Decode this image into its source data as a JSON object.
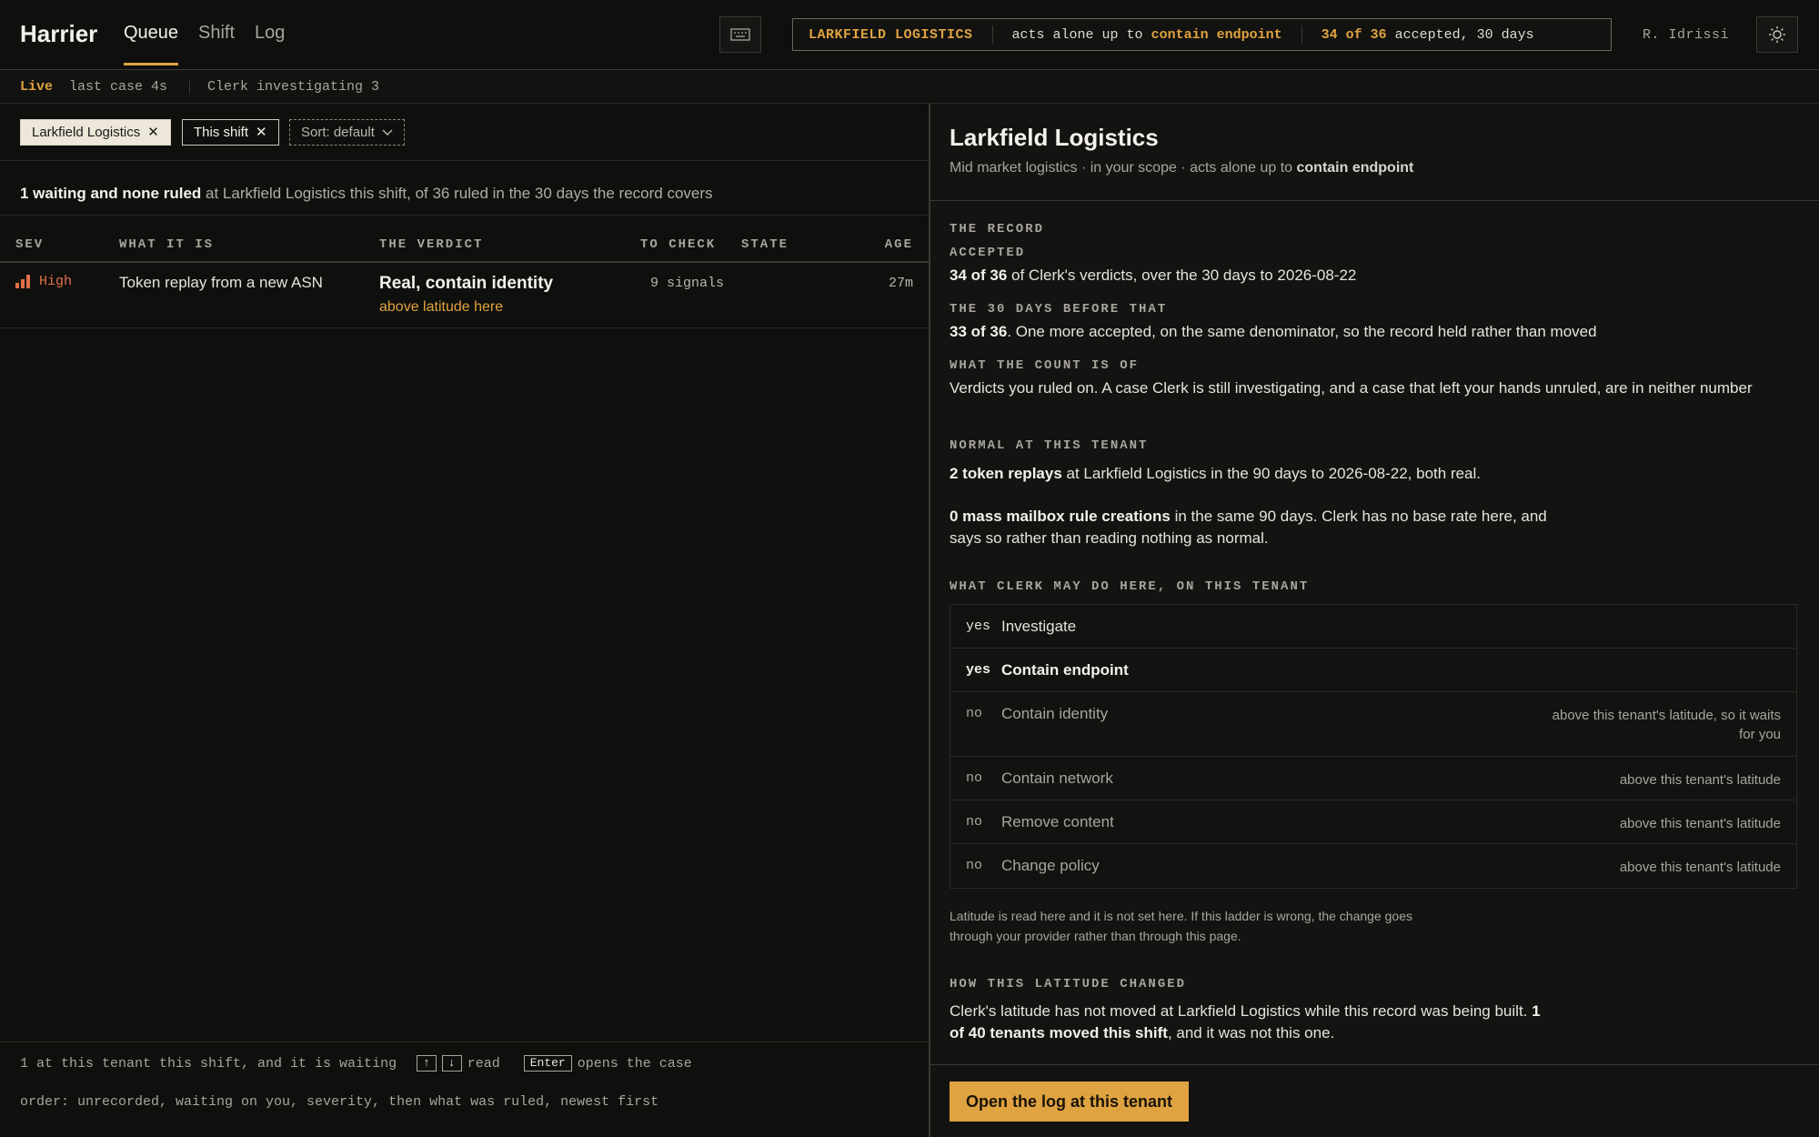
{
  "app": {
    "brand": "Harrier",
    "tabs": [
      {
        "label": "Queue",
        "active": true
      },
      {
        "label": "Shift",
        "active": false
      },
      {
        "label": "Log",
        "active": false
      }
    ],
    "user": "R. Idrissi",
    "icons": {
      "keyboard": "keyboard-icon",
      "theme": "sun-icon"
    }
  },
  "scope": {
    "tenant": "LARKFIELD LOGISTICS",
    "acts_prefix": "acts alone up to",
    "acts_level": "contain endpoint",
    "record_count": "34 of 36",
    "record_suffix": "accepted, 30 days"
  },
  "status": {
    "live": "Live",
    "last_case": "last case 4s",
    "clerk": "Clerk investigating 3"
  },
  "filters": {
    "tenant_chip": "Larkfield Logistics",
    "shift_chip": "This shift",
    "sort_chip": "Sort: default"
  },
  "summary": {
    "bold": "1 waiting and none ruled",
    "rest": " at Larkfield Logistics this shift, of 36 ruled in the 30 days the record covers"
  },
  "table": {
    "headers": [
      "SEV",
      "WHAT IT IS",
      "THE VERDICT",
      "TO CHECK",
      "STATE",
      "AGE"
    ],
    "rows": [
      {
        "sev": "High",
        "what": "Token replay from a new ASN",
        "verdict": "Real, contain identity",
        "verdict_note": "above latitude here",
        "to_check": "9 signals",
        "state": "",
        "age": "27m"
      }
    ]
  },
  "footer": {
    "line1_prefix": "1 at this tenant this shift, and it is waiting",
    "key_up": "↑",
    "key_down": "↓",
    "read": "read",
    "key_enter": "Enter",
    "opens": "opens the case",
    "line2": "order: unrecorded, waiting on you, severity, then what was ruled, newest first"
  },
  "detail": {
    "title": "Larkfield Logistics",
    "subtitle_prefix": "Mid market logistics · in your scope · acts alone up to ",
    "subtitle_bold": "contain endpoint",
    "record_label_1": "THE RECORD",
    "record_label_2": "ACCEPTED",
    "record_bold": "34 of 36",
    "record_rest": " of Clerk's verdicts, over the 30 days to 2026-08-22",
    "before_label": "THE 30 DAYS BEFORE THAT",
    "before_bold": "33 of 36",
    "before_rest": ". One more accepted, on the same denominator, so the record held rather than moved",
    "count_label": "WHAT THE COUNT IS OF",
    "count_text": "Verdicts you ruled on. A case Clerk is still investigating, and a case that left your hands unruled, are in neither number",
    "normal_label": "NORMAL AT THIS TENANT",
    "normal1_bold": "2 token replays",
    "normal1_rest": " at Larkfield Logistics in the 90 days to 2026-08-22, both real.",
    "normal2_bold": "0 mass mailbox rule creations",
    "normal2_rest_a": " in the same 90 days. Clerk has no base rate here, and",
    "normal2_rest_b": "says so rather than reading nothing as normal.",
    "may_label": "WHAT CLERK MAY DO HERE, ON THIS TENANT",
    "ladder": [
      {
        "yn": "yes",
        "action": "Investigate",
        "why": ""
      },
      {
        "yn": "yes",
        "action": "Contain endpoint",
        "why": ""
      },
      {
        "yn": "no",
        "action": "Contain identity",
        "why": "above this tenant's latitude, so it waits for you"
      },
      {
        "yn": "no",
        "action": "Contain network",
        "why": "above this tenant's latitude"
      },
      {
        "yn": "no",
        "action": "Remove content",
        "why": "above this tenant's latitude"
      },
      {
        "yn": "no",
        "action": "Change policy",
        "why": "above this tenant's latitude"
      }
    ],
    "latitude_note_a": "Latitude is read here and it is not set here. If this ladder is wrong, the change goes",
    "latitude_note_b": "through your provider rather than through this page.",
    "changed_label": "HOW THIS LATITUDE CHANGED",
    "changed_a": "Clerk's latitude has not moved at Larkfield Logistics while this record was being built. ",
    "changed_bold_a": "1",
    "changed_bold_b": "of 40 tenants moved this shift",
    "changed_b": ", and it was not this one.",
    "cta": "Open the log at this tenant"
  }
}
